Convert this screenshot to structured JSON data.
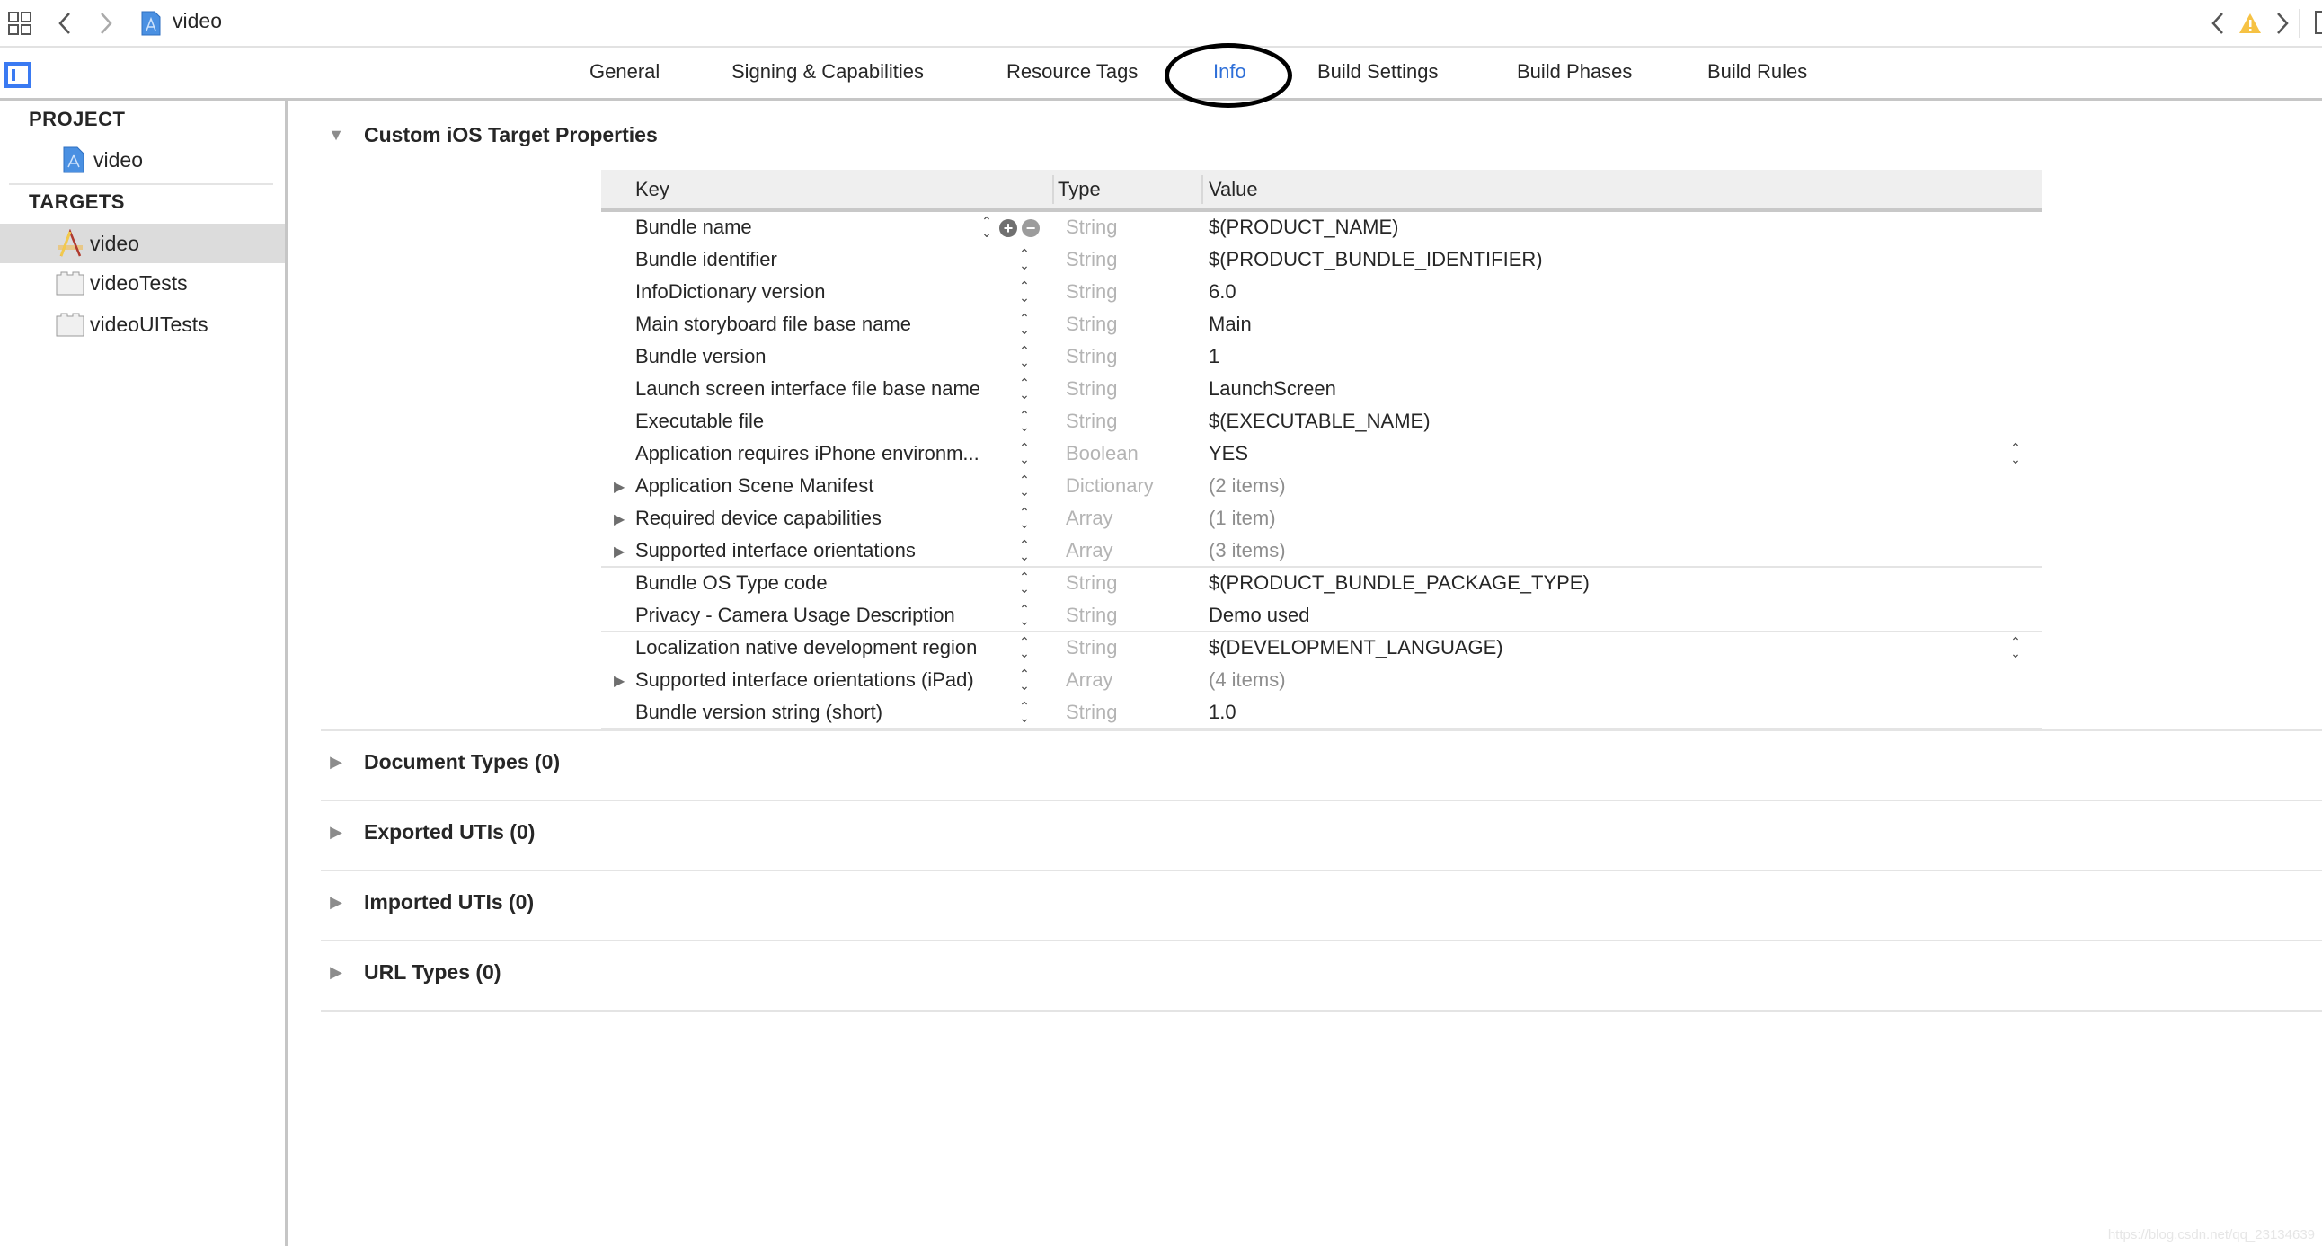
{
  "toolbar": {
    "breadcrumb": "video",
    "icons": {
      "grid": "grid-icon",
      "back": "chevron-left-icon",
      "forward": "chevron-right-icon",
      "file": "xcode-project-icon",
      "warning": "warning-icon"
    },
    "warning_color": "#f6c244"
  },
  "tabs": [
    {
      "label": "General",
      "active": false
    },
    {
      "label": "Signing & Capabilities",
      "active": false
    },
    {
      "label": "Resource Tags",
      "active": false
    },
    {
      "label": "Info",
      "active": true
    },
    {
      "label": "Build Settings",
      "active": false
    },
    {
      "label": "Build Phases",
      "active": false
    },
    {
      "label": "Build Rules",
      "active": false
    }
  ],
  "accent_color": "#2e6fd8",
  "sidebar": {
    "project_header": "PROJECT",
    "project_items": [
      {
        "label": "video",
        "icon": "project-file-icon"
      }
    ],
    "targets_header": "TARGETS",
    "target_items": [
      {
        "label": "video",
        "icon": "app-target-icon",
        "selected": true
      },
      {
        "label": "videoTests",
        "icon": "test-bundle-icon",
        "selected": false
      },
      {
        "label": "videoUITests",
        "icon": "test-bundle-icon",
        "selected": false
      }
    ]
  },
  "main": {
    "custom_properties": {
      "title": "Custom iOS Target Properties",
      "expanded": true,
      "columns": {
        "key": "Key",
        "type": "Type",
        "value": "Value"
      },
      "rows": [
        {
          "key": "Bundle name",
          "type": "String",
          "value": "$(PRODUCT_NAME)",
          "expandable": false
        },
        {
          "key": "Bundle identifier",
          "type": "String",
          "value": "$(PRODUCT_BUNDLE_IDENTIFIER)",
          "expandable": false
        },
        {
          "key": "InfoDictionary version",
          "type": "String",
          "value": "6.0",
          "expandable": false
        },
        {
          "key": "Main storyboard file base name",
          "type": "String",
          "value": "Main",
          "expandable": false
        },
        {
          "key": "Bundle version",
          "type": "String",
          "value": "1",
          "expandable": false
        },
        {
          "key": "Launch screen interface file base name",
          "type": "String",
          "value": "LaunchScreen",
          "expandable": false
        },
        {
          "key": "Executable file",
          "type": "String",
          "value": "$(EXECUTABLE_NAME)",
          "expandable": false
        },
        {
          "key": "Application requires iPhone environm...",
          "type": "Boolean",
          "value": "YES",
          "expandable": false
        },
        {
          "key": "Application Scene Manifest",
          "type": "Dictionary",
          "value": "(2 items)",
          "expandable": true
        },
        {
          "key": "Required device capabilities",
          "type": "Array",
          "value": "(1 item)",
          "expandable": true
        },
        {
          "key": "Supported interface orientations",
          "type": "Array",
          "value": "(3 items)",
          "expandable": true
        },
        {
          "key": "Bundle OS Type code",
          "type": "String",
          "value": "$(PRODUCT_BUNDLE_PACKAGE_TYPE)",
          "expandable": false
        },
        {
          "key": "Privacy - Camera Usage Description",
          "type": "String",
          "value": "Demo used",
          "expandable": false
        },
        {
          "key": "Localization native development region",
          "type": "String",
          "value": "$(DEVELOPMENT_LANGUAGE)",
          "expandable": false
        },
        {
          "key": "Supported interface orientations (iPad)",
          "type": "Array",
          "value": "(4 items)",
          "expandable": true
        },
        {
          "key": "Bundle version string (short)",
          "type": "String",
          "value": "1.0",
          "expandable": false
        }
      ]
    },
    "sections": [
      {
        "title": "Document Types (0)"
      },
      {
        "title": "Exported UTIs (0)"
      },
      {
        "title": "Imported UTIs (0)"
      },
      {
        "title": "URL Types (0)"
      }
    ]
  },
  "watermark": "https://blog.csdn.net/qq_23134639"
}
